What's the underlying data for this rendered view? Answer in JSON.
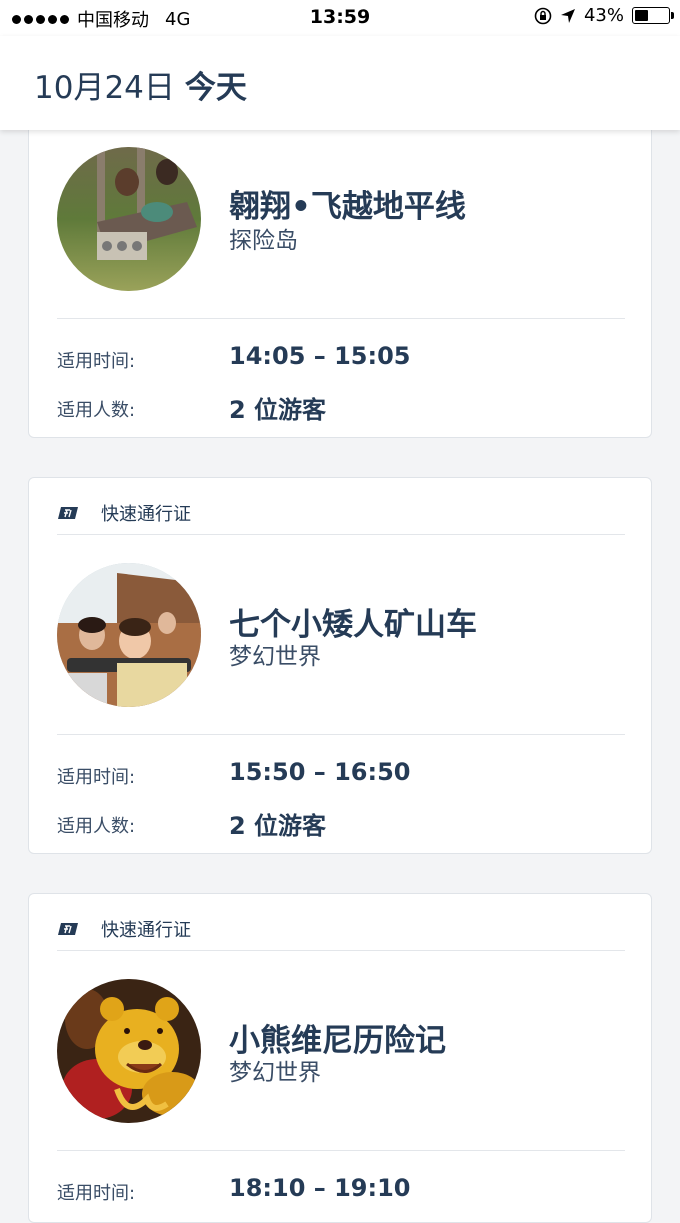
{
  "status_bar": {
    "carrier": "中国移动",
    "network": "4G",
    "time": "13:59",
    "battery": "43%",
    "battery_level": 0.43
  },
  "header": {
    "date": "10月24日",
    "today": "今天"
  },
  "cards": [
    {
      "badge": "",
      "name": "翱翔•飞越地平线",
      "land": "探险岛",
      "time_label": "适用时间:",
      "time_value": "14:05 – 15:05",
      "guests_label": "适用人数:",
      "guests_value": "2 位游客"
    },
    {
      "badge": "快速通行证",
      "name": "七个小矮人矿山车",
      "land": "梦幻世界",
      "time_label": "适用时间:",
      "time_value": "15:50 – 16:50",
      "guests_label": "适用人数:",
      "guests_value": "2 位游客"
    },
    {
      "badge": "快速通行证",
      "name": "小熊维尼历险记",
      "land": "梦幻世界",
      "time_label": "适用时间:",
      "time_value": "18:10 – 19:10"
    }
  ],
  "icons": {
    "fastpass": "fastpass-icon",
    "location": "location-arrow-icon",
    "lock": "orientation-lock-icon"
  },
  "colors": {
    "text_primary": "#253b56",
    "background": "#f3f4f6",
    "card": "#ffffff"
  }
}
